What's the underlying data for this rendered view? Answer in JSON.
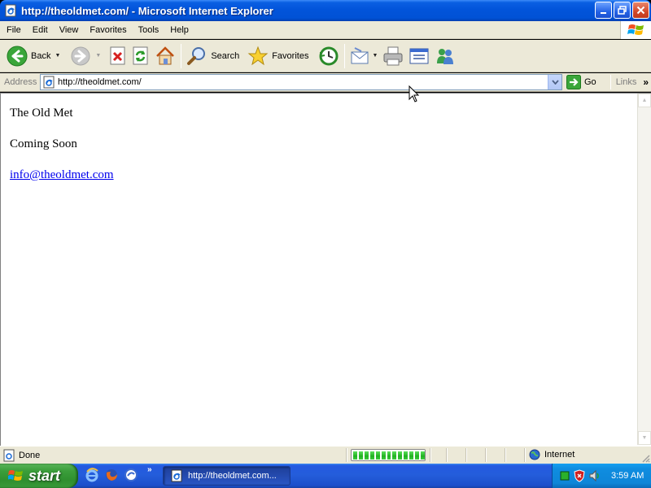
{
  "window": {
    "title": "http://theoldmet.com/ - Microsoft Internet Explorer"
  },
  "menu": {
    "items": [
      "File",
      "Edit",
      "View",
      "Favorites",
      "Tools",
      "Help"
    ]
  },
  "toolbar": {
    "back_label": "Back",
    "search_label": "Search",
    "favorites_label": "Favorites"
  },
  "address": {
    "label": "Address",
    "url": "http://theoldmet.com/",
    "go_label": "Go",
    "links_label": "Links"
  },
  "page": {
    "title": "The Old Met",
    "subtitle": "Coming Soon",
    "email": "info@theoldmet.com"
  },
  "status": {
    "text": "Done",
    "zone": "Internet",
    "progress_fraction": 1.0
  },
  "taskbar": {
    "start_label": "start",
    "task_label": "http://theoldmet.com...",
    "clock": "3:59 AM"
  },
  "colors": {
    "title_bar": "#0254da",
    "chrome": "#ece9d8",
    "start_green": "#3b9e3b",
    "link": "#0000ee"
  },
  "icons": [
    "ie-page-icon",
    "back-icon",
    "forward-icon",
    "stop-icon",
    "refresh-icon",
    "home-icon",
    "search-icon",
    "favorites-star-icon",
    "history-icon",
    "mail-icon",
    "print-icon",
    "edit-icon",
    "messenger-icon",
    "go-arrow-icon",
    "globe-icon",
    "windows-flag-icon"
  ]
}
